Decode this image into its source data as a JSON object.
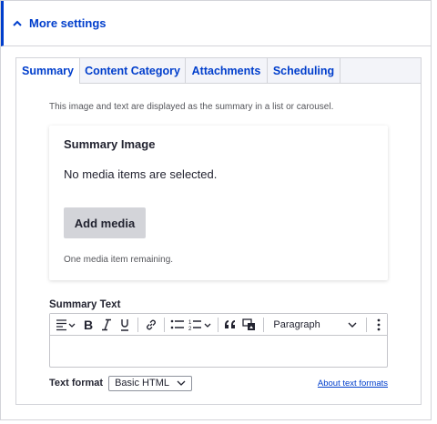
{
  "details": {
    "title": "More settings"
  },
  "tabs": [
    {
      "label": "Summary"
    },
    {
      "label": "Content Category"
    },
    {
      "label": "Attachments"
    },
    {
      "label": "Scheduling"
    }
  ],
  "summary": {
    "description": "This image and text are displayed as the summary in a list or carousel.",
    "image_title": "Summary Image",
    "empty_text": "No media items are selected.",
    "add_media_label": "Add media",
    "remaining_note": "One media item remaining."
  },
  "summary_text": {
    "label": "Summary Text",
    "paragraph_select": "Paragraph",
    "toolbar_icons": [
      "align-icon",
      "bold-icon",
      "italic-icon",
      "underline-icon",
      "link-icon",
      "bulleted-list-icon",
      "numbered-list-icon",
      "blockquote-icon",
      "media-icon",
      "more-icon"
    ]
  },
  "text_format": {
    "label": "Text format",
    "value": "Basic HTML",
    "help_link": "About text formats"
  },
  "colors": {
    "accent": "#003ecc",
    "border": "#d3d4d9",
    "button_bg": "#d3d4d9"
  }
}
